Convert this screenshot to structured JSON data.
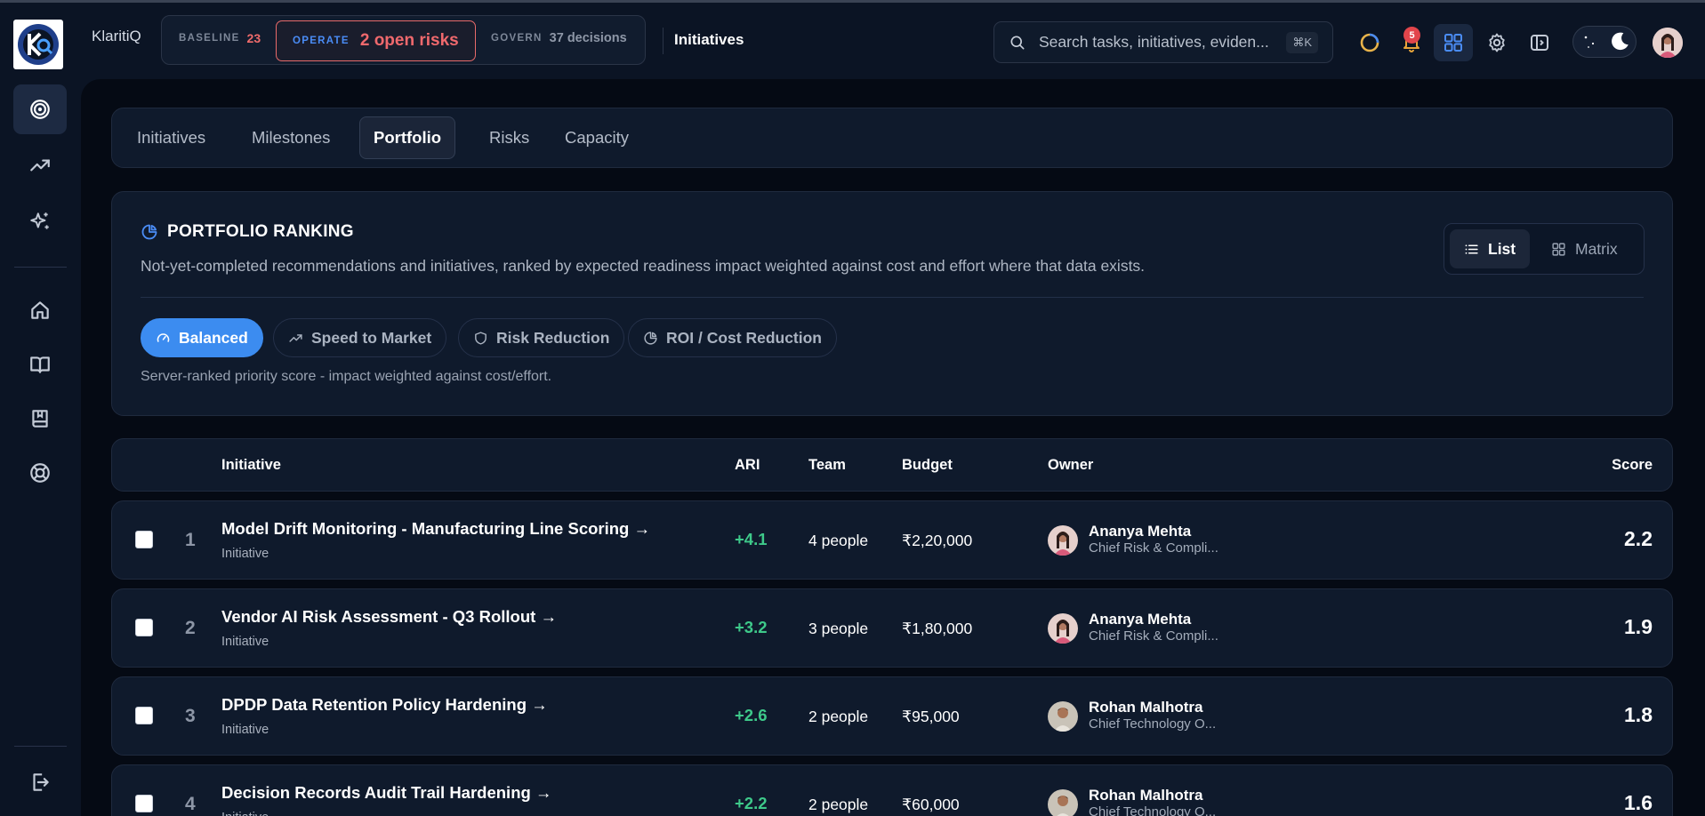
{
  "app": {
    "brand": "KlaritiQ"
  },
  "phases": {
    "baseline": {
      "label": "BASELINE",
      "count": "23"
    },
    "operate": {
      "label": "OPERATE",
      "count": "2 open risks"
    },
    "govern": {
      "label": "GOVERN",
      "count": "37 decisions"
    }
  },
  "header": {
    "page": "Initiatives",
    "search_placeholder": "Search tasks, initiatives, eviden...",
    "search_shortcut": "⌘K",
    "notification_count": "5"
  },
  "tabs": [
    {
      "label": "Initiatives"
    },
    {
      "label": "Milestones"
    },
    {
      "label": "Portfolio",
      "active": true
    },
    {
      "label": "Risks"
    },
    {
      "label": "Capacity"
    }
  ],
  "ranking": {
    "title": "PORTFOLIO RANKING",
    "description": "Not-yet-completed recommendations and initiatives, ranked by expected readiness impact weighted against cost and effort where that data exists.",
    "views": {
      "list": "List",
      "matrix": "Matrix"
    },
    "modes": [
      {
        "label": "Balanced",
        "active": true
      },
      {
        "label": "Speed to Market"
      },
      {
        "label": "Risk Reduction"
      },
      {
        "label": "ROI / Cost Reduction"
      }
    ],
    "note": "Server-ranked priority score - impact weighted against cost/effort."
  },
  "table": {
    "headers": {
      "initiative": "Initiative",
      "ari": "ARI",
      "team": "Team",
      "budget": "Budget",
      "owner": "Owner",
      "score": "Score"
    },
    "rows": [
      {
        "rank": "1",
        "title": "Model Drift Monitoring - Manufacturing Line Scoring →",
        "type": "Initiative",
        "ari": "+4.1",
        "team": "4 people",
        "budget": "₹2,20,000",
        "owner": "Ananya Mehta",
        "role": "Chief Risk & Compli...",
        "score": "2.2"
      },
      {
        "rank": "2",
        "title": "Vendor AI Risk Assessment - Q3 Rollout →",
        "type": "Initiative",
        "ari": "+3.2",
        "team": "3 people",
        "budget": "₹1,80,000",
        "owner": "Ananya Mehta",
        "role": "Chief Risk & Compli...",
        "score": "1.9"
      },
      {
        "rank": "3",
        "title": "DPDP Data Retention Policy Hardening →",
        "type": "Initiative",
        "ari": "+2.6",
        "team": "2 people",
        "budget": "₹95,000",
        "owner": "Rohan Malhotra",
        "role": "Chief Technology O...",
        "score": "1.8"
      },
      {
        "rank": "4",
        "title": "Decision Records Audit Trail Hardening →",
        "type": "Initiative",
        "ari": "+2.2",
        "team": "2 people",
        "budget": "₹60,000",
        "owner": "Rohan Malhotra",
        "role": "Chief Technology O...",
        "score": "1.6"
      }
    ]
  },
  "colors": {
    "accent": "#3c8cf0",
    "positive": "#3ec98a",
    "danger": "#f0696d",
    "background": "#050a14",
    "card": "#0f1a2c"
  }
}
